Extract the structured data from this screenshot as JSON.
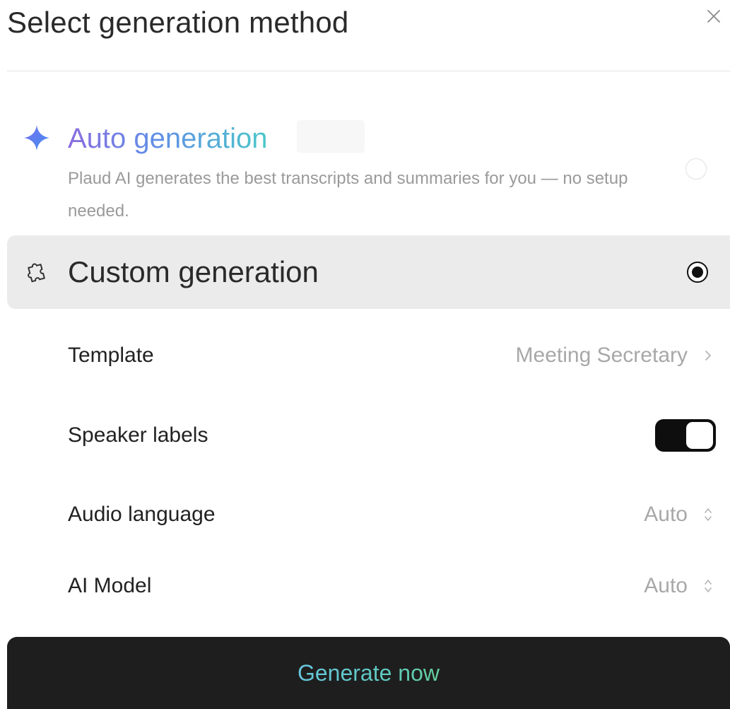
{
  "dialog": {
    "title": "Select generation method"
  },
  "auto_generation": {
    "title": "Auto generation",
    "description": "Plaud AI generates the best transcripts and summaries for you — no setup needed.",
    "selected": false,
    "icon": "sparkle-icon"
  },
  "custom_generation": {
    "title": "Custom generation",
    "selected": true,
    "icon": "puzzle-icon"
  },
  "settings": {
    "template": {
      "label": "Template",
      "value": "Meeting Secretary"
    },
    "speaker_labels": {
      "label": "Speaker labels",
      "enabled": true
    },
    "audio_language": {
      "label": "Audio language",
      "value": "Auto"
    },
    "ai_model": {
      "label": "AI Model",
      "value": "Auto"
    }
  },
  "actions": {
    "generate_label": "Generate now"
  },
  "colors": {
    "button_background": "#1e1e1e",
    "selected_row_background": "#ebebeb",
    "muted_text": "#a8a8a8"
  }
}
